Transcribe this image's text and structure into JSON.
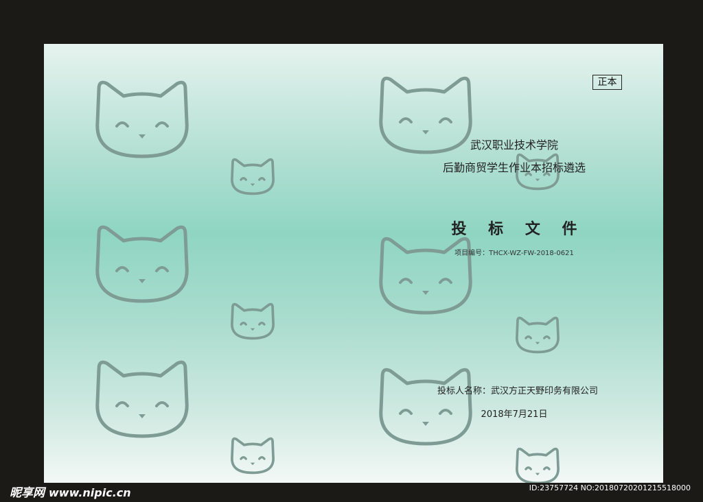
{
  "cover": {
    "badge": "正本",
    "org_line": "武汉职业技术学院",
    "project_line": "后勤商贸学生作业本招标遴选",
    "doc_title": "投 标 文 件",
    "project_code": "项目编号：THCX-WZ-FW-2018-0621",
    "bidder": "投标人名称：武汉方正天野印务有限公司",
    "date": "2018年7月21日"
  },
  "watermark": {
    "brand": "昵享网",
    "site": "www.nipic.cn",
    "id_text": "ID:23757724 NO:20180720201215518000"
  },
  "decor": {
    "icon": "cat-face-icon",
    "stroke_color": "#7e9c93",
    "gradient_center": "#8fd5c2"
  }
}
